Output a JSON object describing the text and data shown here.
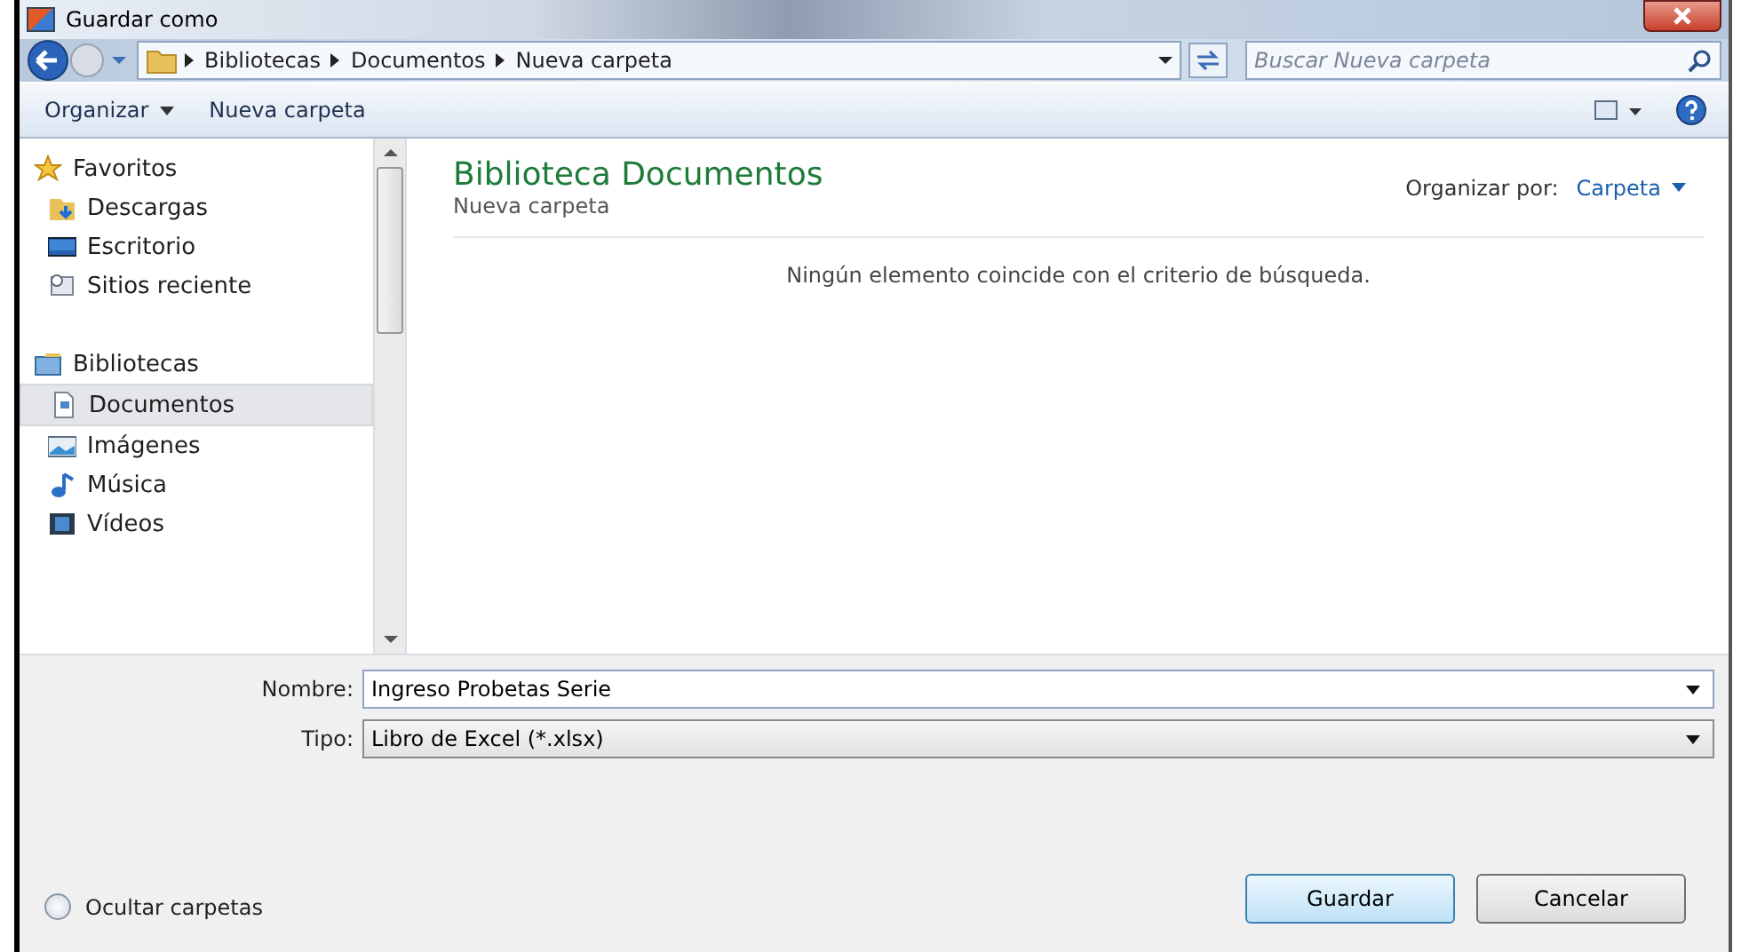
{
  "window": {
    "title": "Guardar como"
  },
  "address_bar": {
    "path": [
      "Bibliotecas",
      "Documentos",
      "Nueva carpeta"
    ]
  },
  "search": {
    "placeholder": "Buscar Nueva carpeta"
  },
  "toolbar": {
    "items": [
      "Organizar",
      "Nueva carpeta"
    ]
  },
  "sidebar": {
    "groups": [
      {
        "label": "Favoritos",
        "children": [
          {
            "label": "Descargas",
            "selected": false
          },
          {
            "label": "Escritorio",
            "selected": false
          },
          {
            "label": "Sitios reciente",
            "selected": false
          }
        ]
      },
      {
        "label": "Bibliotecas",
        "children": [
          {
            "label": "Documentos",
            "selected": true
          },
          {
            "label": "Imágenes",
            "selected": false
          },
          {
            "label": "Música",
            "selected": false
          },
          {
            "label": "Vídeos",
            "selected": false
          }
        ]
      }
    ]
  },
  "content": {
    "title": "Biblioteca Documentos",
    "subtitle": "Nueva carpeta",
    "arrange_label": "Organizar por:",
    "arrange_value": "Carpeta",
    "empty_message": "Ningún elemento coincide con el criterio de búsqueda."
  },
  "form": {
    "fields": [
      {
        "label": "Nombre:",
        "value": "Ingreso Probetas Serie",
        "kind": "editable"
      },
      {
        "label": "Tipo:",
        "value": "Libro de Excel (*.xlsx)",
        "kind": "select"
      }
    ]
  },
  "footer": {
    "toggle": "Ocultar carpetas",
    "buttons": [
      {
        "label": "Guardar",
        "kind": "default"
      },
      {
        "label": "Cancelar",
        "kind": "normal"
      }
    ]
  }
}
